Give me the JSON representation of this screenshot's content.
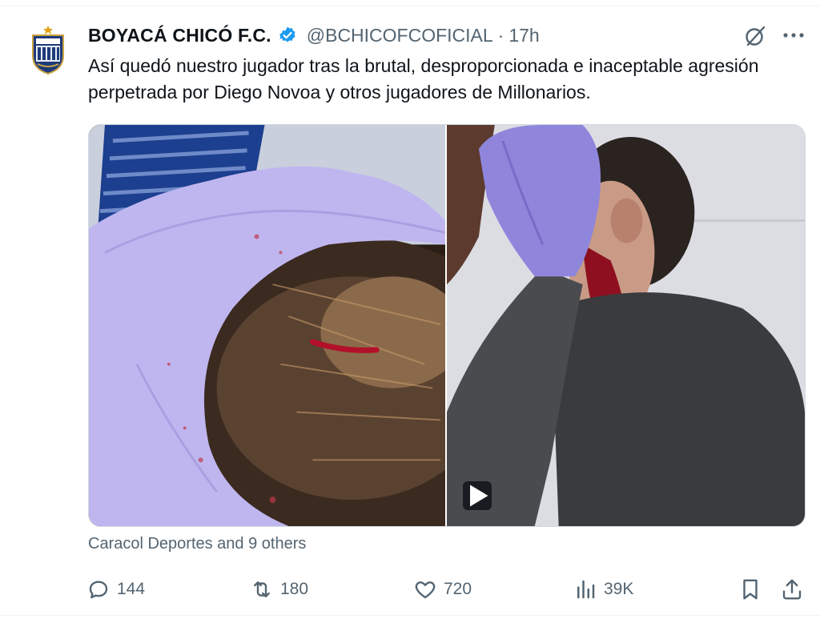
{
  "tweet": {
    "display_name": "BOYACÁ CHICÓ F.C.",
    "handle": "@BCHICOFCOFICIAL",
    "separator": "·",
    "time": "17h",
    "text": "Así quedó nuestro jugador tras la brutal, desproporcionada e inaceptable agresión perpetrada por Diego Novoa y otros jugadores de Millonarios.",
    "tagged": "Caracol Deportes and 9 others",
    "verified_icon": "verified-badge-icon",
    "accent_color": "#1d9bf0"
  },
  "media": {
    "left_photo": {
      "kind": "photo"
    },
    "right_photo": {
      "kind": "video",
      "play_icon": "play-icon"
    }
  },
  "actions": {
    "reply_count": "144",
    "retweet_count": "180",
    "like_count": "720",
    "views_count": "39K",
    "icons": [
      "reply-icon",
      "retweet-icon",
      "like-icon",
      "views-icon",
      "bookmark-icon",
      "share-icon"
    ]
  },
  "colors": {
    "text_primary": "#0f1419",
    "text_secondary": "#536471",
    "border": "#cfd9de",
    "verified": "#1d9bf0"
  }
}
